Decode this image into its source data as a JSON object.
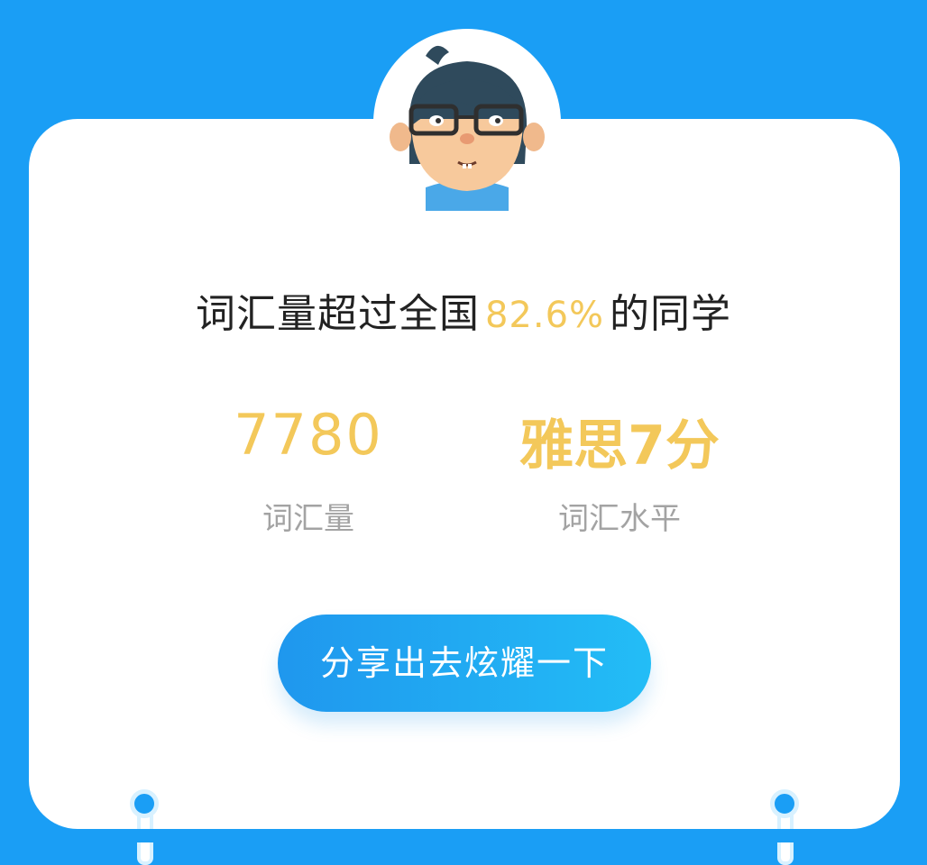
{
  "headline": {
    "prefix": "词汇量超过全国",
    "percent": "82.6%",
    "suffix": "的同学"
  },
  "stats": [
    {
      "value": "7780",
      "label": "词汇量"
    },
    {
      "value": "雅思7分",
      "label": "词汇水平"
    }
  ],
  "share_button": {
    "label": "分享出去炫耀一下"
  },
  "avatar": {
    "icon": "cartoon-boy-with-glasses-icon"
  },
  "colors": {
    "background": "#1a9ef5",
    "accent": "#f3c85a",
    "label_gray": "#a3a3a3",
    "button_start": "#1f97ee",
    "button_end": "#23bdf6"
  }
}
